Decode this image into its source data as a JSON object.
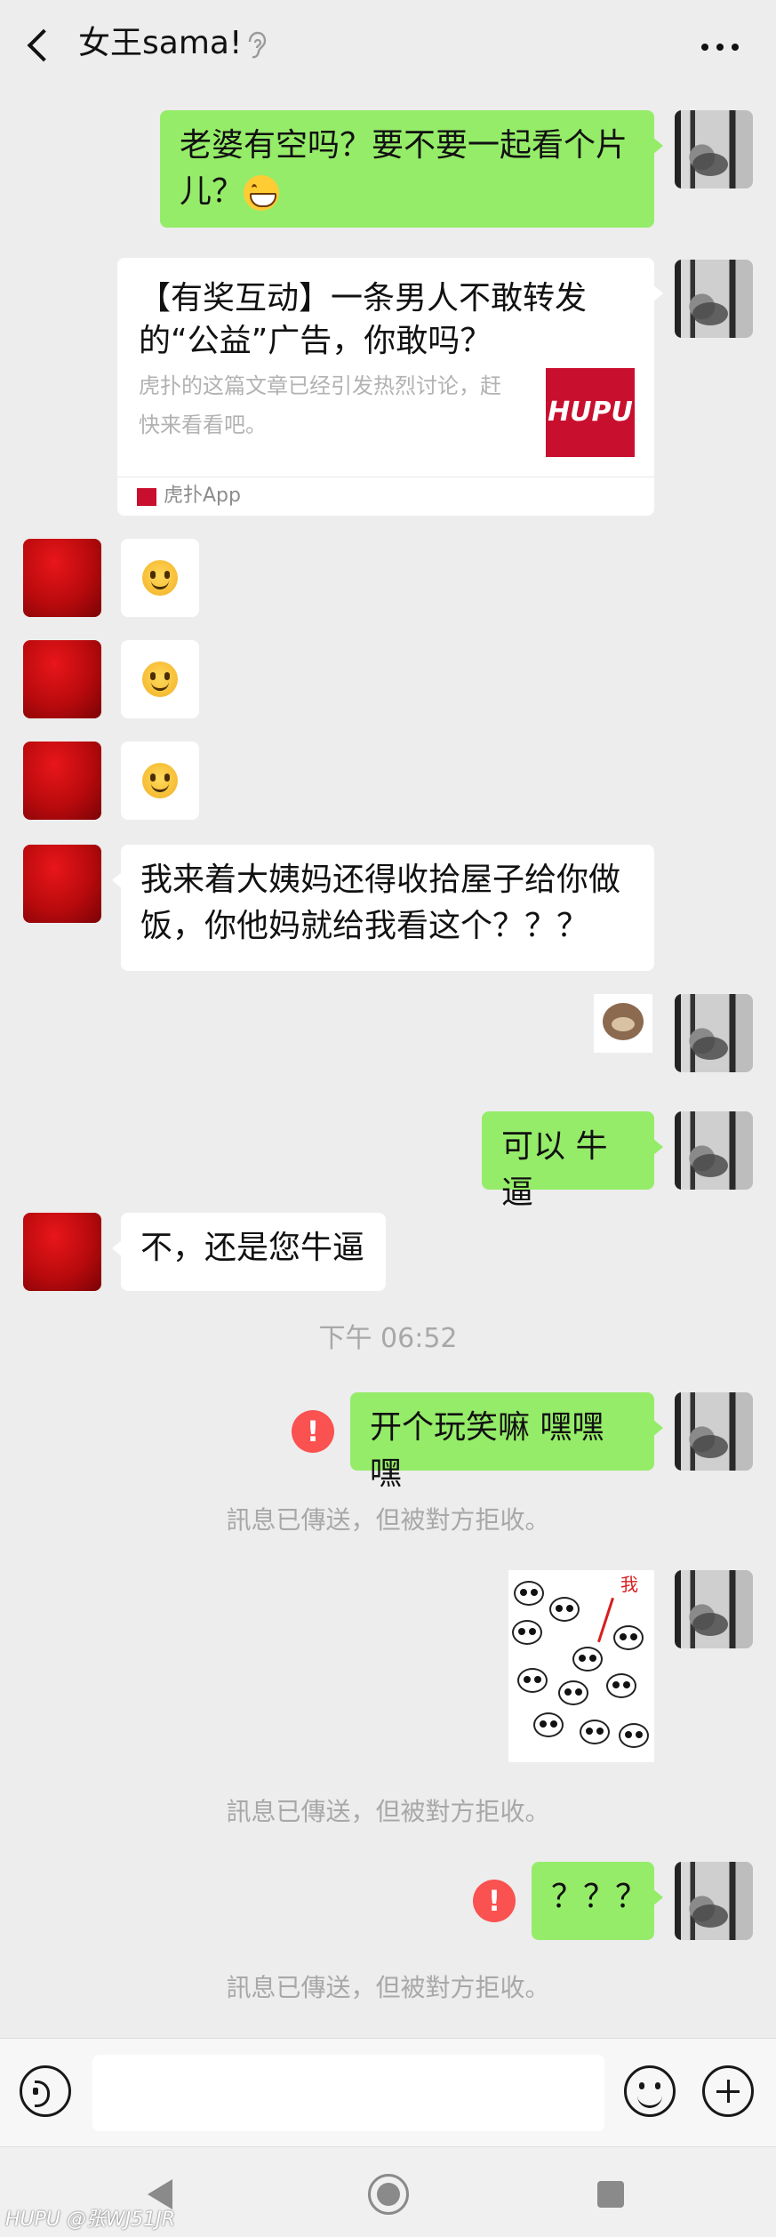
{
  "header": {
    "title": "女王sama!",
    "back_icon": "chevron-left-icon",
    "mute_icon": "ear-icon",
    "more_icon": "more-dots-icon"
  },
  "messages": {
    "m1_text": "老婆有空吗？要不要一起看个片儿？",
    "m2_card": {
      "title": "【有奖互动】一条男人不敢转发的“公益”广告，你敢吗？",
      "desc": "虎扑的这篇文章已经引发热烈讨论，赶快来看看吧。",
      "logo_text": "HUPU",
      "source": "虎扑App"
    },
    "m6_text": "我来着大姨妈还得收拾屋子给你做饭，你他妈就给我看这个？？？",
    "m8_text": "可以 牛逼",
    "m9_text": "不，还是您牛逼",
    "timestamp": "下午 06:52",
    "m10_text": "开个玩笑嘛 嘿嘿嘿",
    "rejected_notice": "訊息已傳送，但被對方拒收。",
    "panda_label": "我",
    "m12_text": "？？？",
    "error_mark": "!"
  },
  "input_bar": {
    "voice_icon": "voice-icon",
    "emoji_icon": "emoji-icon",
    "plus_icon": "plus-icon"
  },
  "nav": {
    "back_icon": "nav-back-icon",
    "home_icon": "nav-home-icon",
    "recent_icon": "nav-recent-icon"
  },
  "watermark": "HUPU @张WJ51JR",
  "colors": {
    "sent_bubble": "#95ec69",
    "received_bubble": "#ffffff",
    "background": "#ededed",
    "error": "#fa5151",
    "hupu_red": "#c8102e"
  }
}
